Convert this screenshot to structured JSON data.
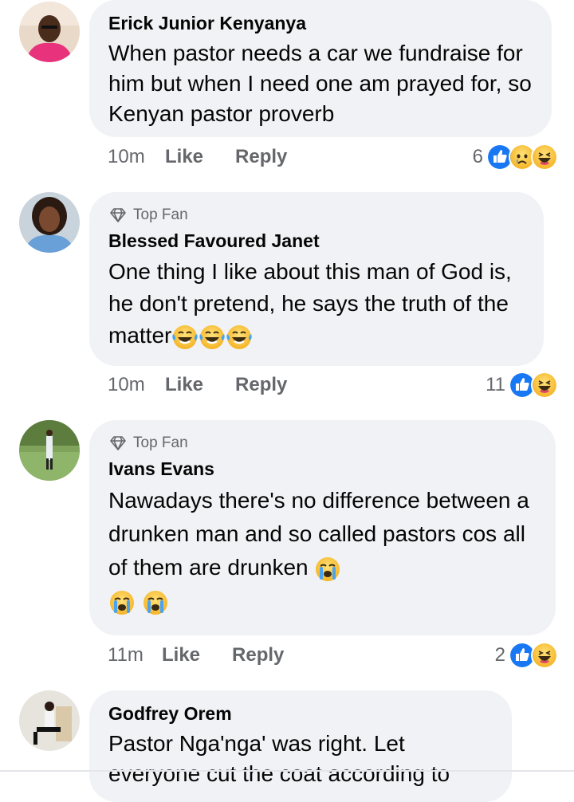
{
  "comments": [
    {
      "author": "Erick Junior Kenyanya",
      "badge": "",
      "text": "When pastor needs a car we fundraise for him but when I need one am prayed for, so Kenyan pastor proverb",
      "time": "10m",
      "like": "Like",
      "reply": "Reply",
      "reaction_count": "6",
      "reactions": [
        "like-icon",
        "sad-icon",
        "haha-icon"
      ]
    },
    {
      "author": "Blessed Favoured Janet",
      "badge": "Top Fan",
      "text": "One thing I like about this man of God is, he don't pretend, he says the truth of the matter",
      "emojis": [
        "laughing-tears-emoji",
        "laughing-tears-emoji",
        "laughing-tears-emoji"
      ],
      "time": "10m",
      "like": "Like",
      "reply": "Reply",
      "reaction_count": "11",
      "reactions": [
        "like-icon",
        "haha-icon"
      ]
    },
    {
      "author": "Ivans Evans",
      "badge": "Top Fan",
      "text": "Nawadays there's no difference between a drunken man and so called pastors cos all of them are drunken",
      "emojis": [
        "crying-emoji",
        "crying-emoji",
        "crying-emoji"
      ],
      "time": "11m",
      "like": "Like",
      "reply": "Reply",
      "reaction_count": "2",
      "reactions": [
        "like-icon",
        "haha-icon"
      ]
    },
    {
      "author": "Godfrey Orem",
      "badge": "",
      "text": "Pastor Nga'nga' was right. Let everyone cut the coat according to"
    }
  ],
  "colors": {
    "bubble": "#f0f2f5",
    "meta_text": "#65676b",
    "like_blue": "#1877f2",
    "emoji_yellow": "#f7c23c"
  }
}
